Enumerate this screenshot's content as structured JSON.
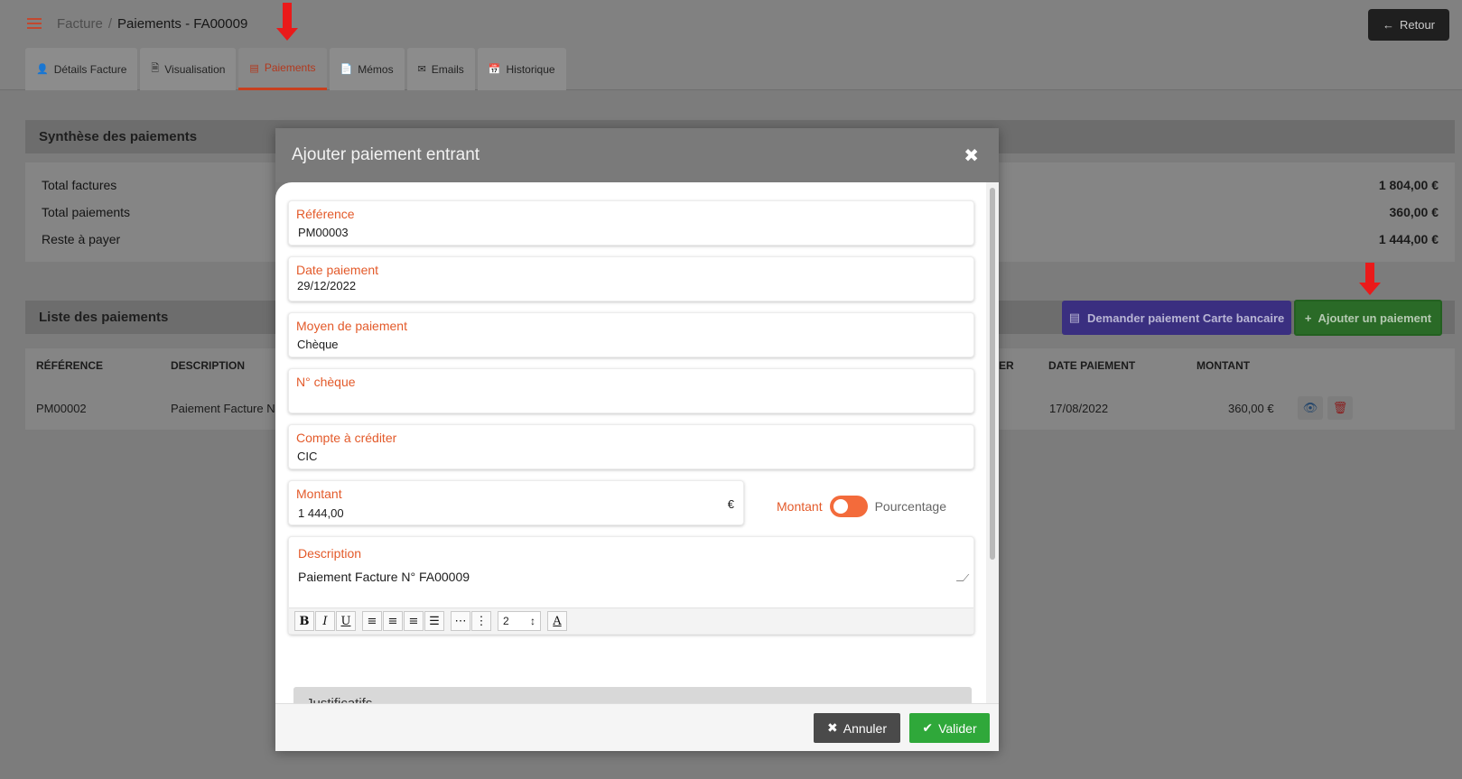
{
  "breadcrumb": {
    "parent": "Facture",
    "separator": "/",
    "current": "Paiements - FA00009"
  },
  "header": {
    "back_label": "Retour"
  },
  "tabs": [
    {
      "label": "Détails Facture",
      "icon": "user-icon"
    },
    {
      "label": "Visualisation",
      "icon": "file-pdf-icon"
    },
    {
      "label": "Paiements",
      "icon": "money-icon",
      "active": true
    },
    {
      "label": "Mémos",
      "icon": "file-icon"
    },
    {
      "label": "Emails",
      "icon": "envelope-icon"
    },
    {
      "label": "Historique",
      "icon": "calendar-icon"
    }
  ],
  "summary": {
    "title": "Synthèse des paiements",
    "rows": [
      {
        "label": "Total factures",
        "value": "1 804,00 €"
      },
      {
        "label": "Total paiements",
        "value": "360,00 €"
      },
      {
        "label": "Reste à payer",
        "value": "1 444,00 €"
      }
    ]
  },
  "payments": {
    "title": "Liste des paiements",
    "card_button": "Demander paiement Carte bancaire",
    "add_button": "Ajouter un paiement",
    "columns": [
      "RÉFÉRENCE",
      "DESCRIPTION",
      "ER",
      "DATE PAIEMENT",
      "MONTANT"
    ],
    "rows": [
      {
        "reference": "PM00002",
        "description": "Paiement Facture N",
        "date": "17/08/2022",
        "amount": "360,00 €"
      }
    ]
  },
  "modal": {
    "title": "Ajouter paiement entrant",
    "fields": {
      "reference": {
        "label": "Référence",
        "value": "PM00003"
      },
      "date": {
        "label": "Date paiement",
        "value": "29/12/2022"
      },
      "method": {
        "label": "Moyen de paiement",
        "value": "Chèque"
      },
      "cheque": {
        "label": "N° chèque",
        "value": ""
      },
      "account": {
        "label": "Compte à créditer",
        "value": "CIC"
      },
      "amount": {
        "label": "Montant",
        "value": "1 444,00",
        "currency": "€"
      },
      "description": {
        "label": "Description",
        "value": "Paiement Facture N° FA00009"
      }
    },
    "toggle": {
      "left_label": "Montant",
      "right_label": "Pourcentage"
    },
    "editor": {
      "bold": "B",
      "italic": "I",
      "underline": "U",
      "font_size": "2",
      "font_color": "A"
    },
    "section_title": "Justificatifs",
    "cancel_label": "Annuler",
    "submit_label": "Valider"
  },
  "colors": {
    "accent": "#e35a2a",
    "success": "#2fa83a",
    "primary": "#3a2f80"
  }
}
